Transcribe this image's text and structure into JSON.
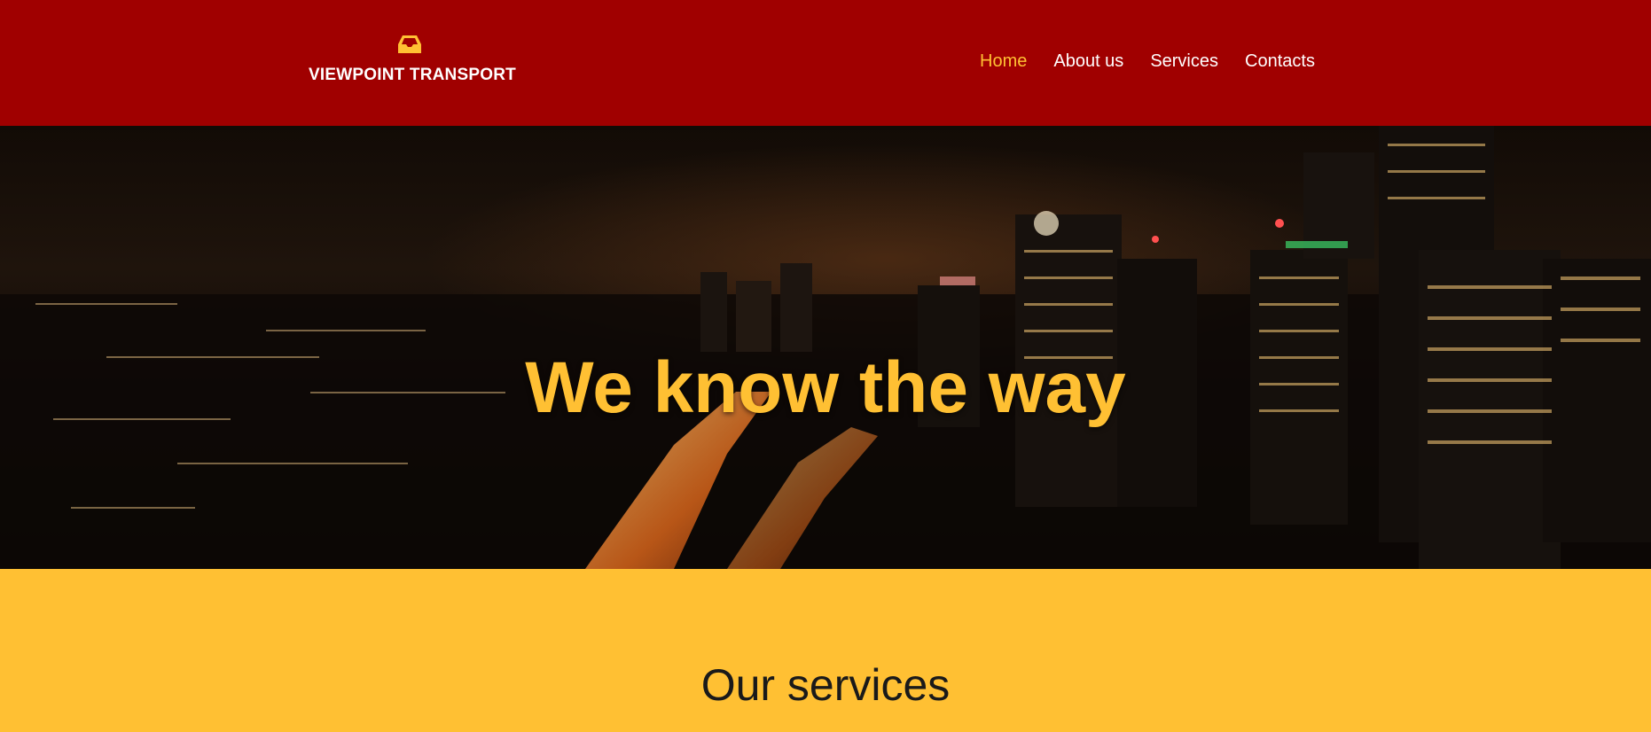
{
  "brand": {
    "name": "VIEWPOINT TRANSPORT",
    "icon": "inbox-tray-icon"
  },
  "nav": {
    "items": [
      {
        "label": "Home",
        "active": true
      },
      {
        "label": "About us",
        "active": false
      },
      {
        "label": "Services",
        "active": false
      },
      {
        "label": "Contacts",
        "active": false
      }
    ]
  },
  "hero": {
    "headline": "We know the way"
  },
  "services": {
    "title": "Our services"
  },
  "colors": {
    "header_bg": "#a00000",
    "accent": "#ffc033",
    "services_bg": "#ffc033",
    "nav_text": "#ffffff"
  }
}
